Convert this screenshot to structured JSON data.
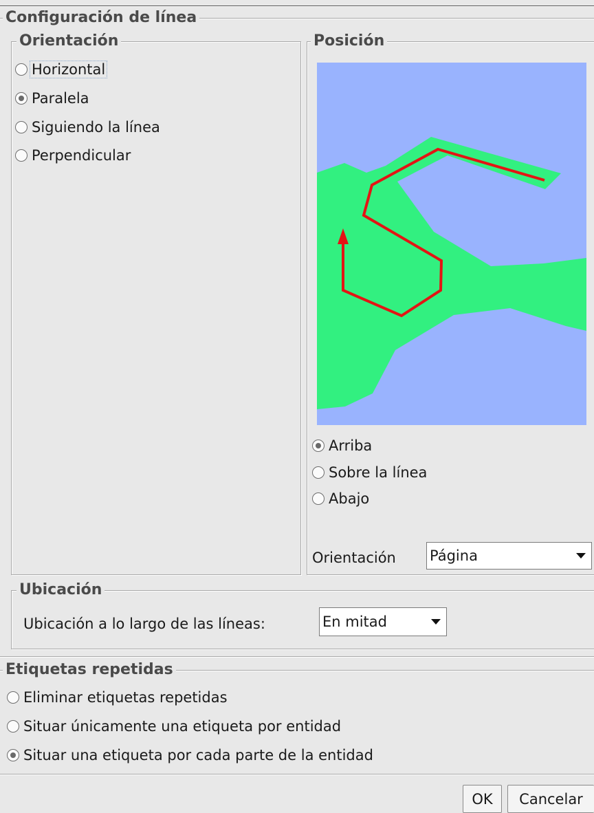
{
  "line_config": {
    "title": "Configuración de línea"
  },
  "orientation": {
    "title": "Orientación",
    "options": [
      {
        "label": "Horizontal",
        "checked": false
      },
      {
        "label": "Paralela",
        "checked": true
      },
      {
        "label": "Siguiendo la línea",
        "checked": false
      },
      {
        "label": "Perpendicular",
        "checked": false
      }
    ]
  },
  "position": {
    "title": "Posición",
    "preview": {
      "water_color": "#99b3fe",
      "land_color": "#32f080",
      "line_color": "#e41414"
    },
    "options": [
      {
        "label": "Arriba",
        "checked": true
      },
      {
        "label": "Sobre la línea",
        "checked": false
      },
      {
        "label": "Abajo",
        "checked": false
      }
    ],
    "orientation_label": "Orientación",
    "orientation_value": "Página"
  },
  "placement": {
    "title": "Ubicación",
    "label": "Ubicación a lo largo de las líneas:",
    "value": "En mitad"
  },
  "repeated": {
    "title": "Etiquetas repetidas",
    "options": [
      {
        "label": "Eliminar etiquetas repetidas",
        "checked": false
      },
      {
        "label": "Situar únicamente una etiqueta por entidad",
        "checked": false
      },
      {
        "label": "Situar una etiqueta por cada parte de la entidad",
        "checked": true
      }
    ]
  },
  "buttons": {
    "ok": "OK",
    "cancel": "Cancelar"
  }
}
